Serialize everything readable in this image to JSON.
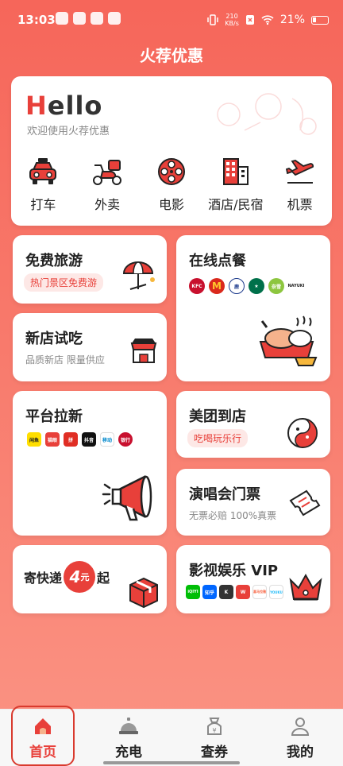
{
  "status_bar": {
    "time": "13:03",
    "net_speed_value": "210",
    "net_speed_unit": "KB/s",
    "battery": "21%"
  },
  "page_title": "火荐优惠",
  "hero": {
    "greeting": "Hello",
    "greeting_first": "H",
    "greeting_rest": "ello",
    "welcome": "欢迎使用火荐优惠",
    "quick_nav": [
      {
        "label": "打车",
        "icon": "taxi-icon"
      },
      {
        "label": "外卖",
        "icon": "scooter-icon"
      },
      {
        "label": "电影",
        "icon": "film-reel-icon"
      },
      {
        "label": "酒店/民宿",
        "icon": "hotel-icon"
      },
      {
        "label": "机票",
        "icon": "airplane-icon"
      }
    ]
  },
  "tiles": {
    "free_travel": {
      "title": "免费旅游",
      "pill": "热门景区免费游"
    },
    "online_food": {
      "title": "在线点餐",
      "brands": [
        "KFC",
        "M",
        "luckin",
        "Starbucks",
        "奈雪",
        "NAYUKI"
      ]
    },
    "new_store": {
      "title": "新店试吃",
      "subtitle": "品质新店 限量供应"
    },
    "platform_new": {
      "title": "平台拉新",
      "apps": [
        "闲鱼",
        "猫眼",
        "拼",
        "抖音",
        "移动",
        "银行"
      ]
    },
    "meituan": {
      "title": "美团到店",
      "pill": "吃喝玩乐行"
    },
    "concert": {
      "title": "演唱会门票",
      "subtitle": "无票必赔 100%真票"
    },
    "express": {
      "title_prefix": "寄快递",
      "price": "4",
      "price_unit": "元",
      "title_suffix": "起"
    },
    "video_vip": {
      "title": "影视娱乐 VIP",
      "apps": [
        "iQIYI",
        "知乎",
        "K",
        "W",
        "喜马拉雅",
        "YOUKU"
      ]
    }
  },
  "bottom_nav": [
    {
      "label": "首页",
      "icon": "home-icon",
      "active": true
    },
    {
      "label": "充电",
      "icon": "charging-bell-icon",
      "active": false
    },
    {
      "label": "查券",
      "icon": "coupon-bag-icon",
      "active": false
    },
    {
      "label": "我的",
      "icon": "profile-icon",
      "active": false
    }
  ],
  "colors": {
    "accent": "#e8403a",
    "background_top": "#f6665a",
    "background_bottom": "#fb9484"
  }
}
